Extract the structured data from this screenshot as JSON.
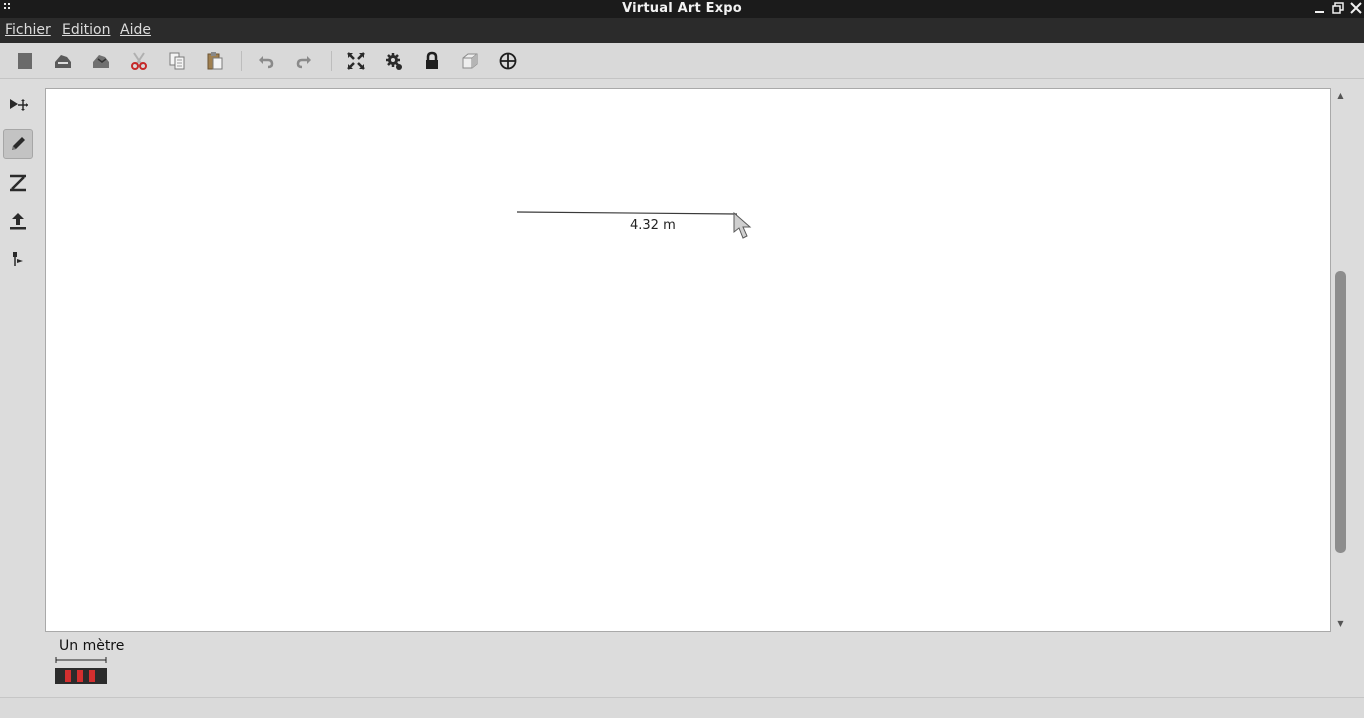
{
  "window": {
    "title": "Virtual Art Expo"
  },
  "menubar": {
    "items": [
      {
        "label": "Fichier"
      },
      {
        "label": "Edition"
      },
      {
        "label": "Aide"
      }
    ]
  },
  "toolbar": {
    "buttons": [
      {
        "icon": "new-icon"
      },
      {
        "icon": "open-icon"
      },
      {
        "icon": "save-icon"
      },
      {
        "icon": "cut-icon"
      },
      {
        "icon": "copy-icon"
      },
      {
        "icon": "paste-icon"
      },
      {
        "icon": "undo-icon"
      },
      {
        "icon": "redo-icon"
      },
      {
        "icon": "fit-view-icon"
      },
      {
        "icon": "settings-gear-icon"
      },
      {
        "icon": "lock-icon"
      },
      {
        "icon": "3d-box-icon"
      },
      {
        "icon": "crosshair-icon"
      }
    ]
  },
  "palette": {
    "tools": [
      {
        "icon": "select-move-icon",
        "active": false
      },
      {
        "icon": "draw-wall-pencil-icon",
        "active": true
      },
      {
        "icon": "dimension-tool-icon",
        "active": false
      },
      {
        "icon": "upload-artwork-icon",
        "active": false
      },
      {
        "icon": "place-light-icon",
        "active": false
      }
    ]
  },
  "canvas": {
    "measurement": "4.32 m"
  },
  "scale": {
    "label": "Un mètre",
    "colors": [
      "#2b2b2b",
      "#d32f2f"
    ]
  },
  "colors": {
    "title_bar": "#1b1b1b",
    "menu_bar": "#2b2b2b",
    "background": "#dcdcdc",
    "canvas": "#ffffff",
    "cut_icon": "#c62828"
  }
}
